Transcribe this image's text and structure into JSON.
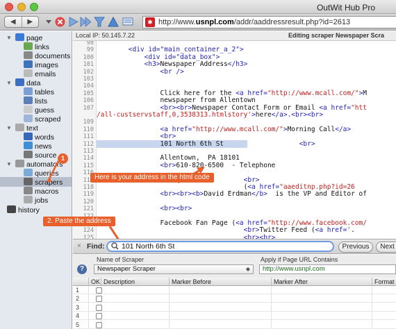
{
  "window": {
    "title": "OutWit Hub Pro"
  },
  "toolbar": {
    "back_glyph": "◀",
    "forward_glyph": "▶",
    "url_prefix": "http://www.",
    "url_domain": "usnpl.com",
    "url_path": "/addr/aaddressresult.php?id=2613",
    "favicon_glyph": "✱"
  },
  "sidebar": {
    "items": [
      {
        "label": "page",
        "icon": "page-icon",
        "color": "#3b7bd6",
        "expanded": true
      },
      {
        "label": "links",
        "icon": "links-icon",
        "color": "#6aa84f"
      },
      {
        "label": "documents",
        "icon": "documents-icon",
        "color": "#888888"
      },
      {
        "label": "images",
        "icon": "images-icon",
        "color": "#3f74b8"
      },
      {
        "label": "emails",
        "icon": "emails-icon",
        "color": "#bbbbbb"
      },
      {
        "label": "data",
        "icon": "data-icon",
        "color": "#3b6fc2",
        "expanded": true
      },
      {
        "label": "tables",
        "icon": "tables-icon",
        "color": "#7a9fd4"
      },
      {
        "label": "lists",
        "icon": "lists-icon",
        "color": "#5c7fb8"
      },
      {
        "label": "guess",
        "icon": "guess-icon",
        "color": "#cccccc"
      },
      {
        "label": "scraped",
        "icon": "scraped-icon",
        "color": "#9fb5d9"
      },
      {
        "label": "text",
        "icon": "text-icon",
        "color": "#aaaaaa",
        "expanded": true
      },
      {
        "label": "words",
        "icon": "words-icon",
        "color": "#3667b8"
      },
      {
        "label": "news",
        "icon": "news-icon",
        "color": "#3f8fd6"
      },
      {
        "label": "source",
        "icon": "source-icon",
        "color": "#777777"
      },
      {
        "label": "automators",
        "icon": "automators-icon",
        "color": "#999999",
        "expanded": true
      },
      {
        "label": "queries",
        "icon": "queries-icon",
        "color": "#7caad8"
      },
      {
        "label": "scrapers",
        "icon": "scrapers-icon",
        "color": "#666666",
        "selected": true
      },
      {
        "label": "macros",
        "icon": "macros-icon",
        "color": "#888888"
      },
      {
        "label": "jobs",
        "icon": "jobs-icon",
        "color": "#aaaaaa"
      },
      {
        "label": "history",
        "icon": "history-icon",
        "color": "#444444"
      }
    ]
  },
  "header": {
    "local_ip": "Local IP:   50.145.7.22",
    "editing": "Editing scraper Newspaper Scra"
  },
  "code_lines": [
    {
      "num": "98",
      "html": ""
    },
    {
      "num": "99",
      "html": "        <span class='tag'>&lt;div id=\"main_container_a_2\"&gt;</span>"
    },
    {
      "num": "100",
      "html": "            <span class='tag'>&lt;div id=\"data_box\"&gt;</span>"
    },
    {
      "num": "101",
      "html": "            <span class='tag'>&lt;h3&gt;</span>Newspaper Address<span class='tag'>&lt;/h3&gt;</span>"
    },
    {
      "num": "102",
      "html": "                <span class='tag'>&lt;br /&gt;</span>"
    },
    {
      "num": "103",
      "html": ""
    },
    {
      "num": "104",
      "html": ""
    },
    {
      "num": "105",
      "html": "                Click here for the <span class='tag'>&lt;a href=</span><span class='link'>\"http://www.mcall.com/\"</span><span class='tag'>&gt;</span>M"
    },
    {
      "num": "106",
      "html": "                newspaper from Allentown"
    },
    {
      "num": "107",
      "html": "                <span class='tag'>&lt;br&gt;&lt;br&gt;</span>Newspaper Contact Form or Email <span class='tag'>&lt;a href=</span><span class='link'>\"htt</span>"
    },
    {
      "num": "",
      "html": "<span class='link'>/all-custservstaff,0,3538313.htmlstory'</span><span class='tag'>&gt;</span>here<span class='tag'>&lt;/a&gt;.&lt;br&gt;&lt;br&gt;</span>"
    },
    {
      "num": "109",
      "html": ""
    },
    {
      "num": "110",
      "html": "                <span class='tag'>&lt;a href=</span><span class='link'>\"http://www.mcall.com/\"</span><span class='tag'>&gt;</span>Morning Call<span class='tag'>&lt;/a&gt;</span>"
    },
    {
      "num": "111",
      "html": "                <span class='tag'>&lt;br&gt;</span>"
    },
    {
      "num": "112",
      "html": "<span class='hl'>                101 North 6th St      </span>             <span class='tag'>&lt;br&gt;</span>"
    },
    {
      "num": "113",
      "html": ""
    },
    {
      "num": "114",
      "html": "                Allentown,  PA 18101"
    },
    {
      "num": "115",
      "html": "                <span class='tag'>&lt;br&gt;</span>610-820-6500  - Telephone"
    },
    {
      "num": "116",
      "html": ""
    },
    {
      "num": "117",
      "html": "                                     <span class='tag'>&lt;br&gt;</span>"
    },
    {
      "num": "118",
      "html": "                                     (<span class='tag'>&lt;a href=</span><span class='link'>\"aaeditnp.php?id=26</span>"
    },
    {
      "num": "119",
      "html": "                <span class='tag'>&lt;br&gt;&lt;br&gt;&lt;b&gt;</span>David Erdman<span class='tag'>&lt;/b&gt;</span>  is the VP and Editor of"
    },
    {
      "num": "120",
      "html": ""
    },
    {
      "num": "121",
      "html": "                <span class='tag'>&lt;br&gt;&lt;br&gt;</span>"
    },
    {
      "num": "122",
      "html": ""
    },
    {
      "num": "123",
      "html": "                Facebook Fan Page (<span class='tag'>&lt;a href=</span><span class='link'>\"http://www.facebook.com/</span>"
    },
    {
      "num": "124",
      "html": "                                     <span class='tag'>&lt;br&gt;</span>Twitter Feed (<span class='tag'>&lt;a href=</span><span class='link'>'</span>."
    },
    {
      "num": "125",
      "html": "                                     <span class='tag'>&lt;br&gt;&lt;br&gt;</span>"
    }
  ],
  "callouts": {
    "step1_badge": "1",
    "address_note": "Here is your address in the html code",
    "step2": "2. Paste the address"
  },
  "find": {
    "close": "×",
    "label": "Find:",
    "value": "101 North 6th St",
    "previous": "Previous",
    "next": "Next"
  },
  "scraper": {
    "name_label": "Name of Scraper",
    "name_value": "Newspaper Scraper",
    "apply_label": "Apply if Page URL Contains",
    "apply_value": "http://www.usnpl.com",
    "help": "?",
    "columns": [
      "OK",
      "Description",
      "Marker Before",
      "Marker After",
      "Format"
    ],
    "rows": [
      "1",
      "2",
      "3",
      "4",
      "5"
    ]
  }
}
